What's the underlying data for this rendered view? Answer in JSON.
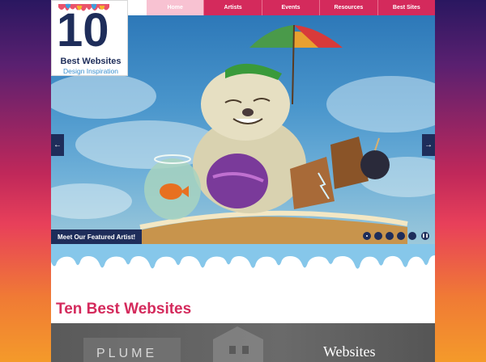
{
  "nav": {
    "items": [
      {
        "label": "Home",
        "active": true
      },
      {
        "label": "Artists"
      },
      {
        "label": "Events"
      },
      {
        "label": "Resources"
      },
      {
        "label": "Best Sites"
      }
    ]
  },
  "logo": {
    "number": "10",
    "title": "Best Websites",
    "subtitle": "Design Inspiration"
  },
  "slider": {
    "prev_icon": "←",
    "next_icon": "→",
    "caption": "Meet Our Featured Artist!",
    "slide_count": 5,
    "active_slide": 1,
    "pause_icon": "❚❚"
  },
  "main": {
    "heading": "Ten Best Websites"
  },
  "banner": {
    "sign_text": "PLUME",
    "text": "Websites"
  },
  "colors": {
    "accent": "#d42a5c",
    "navy": "#1e2d5a",
    "drip_blue": "#86c7ea"
  }
}
